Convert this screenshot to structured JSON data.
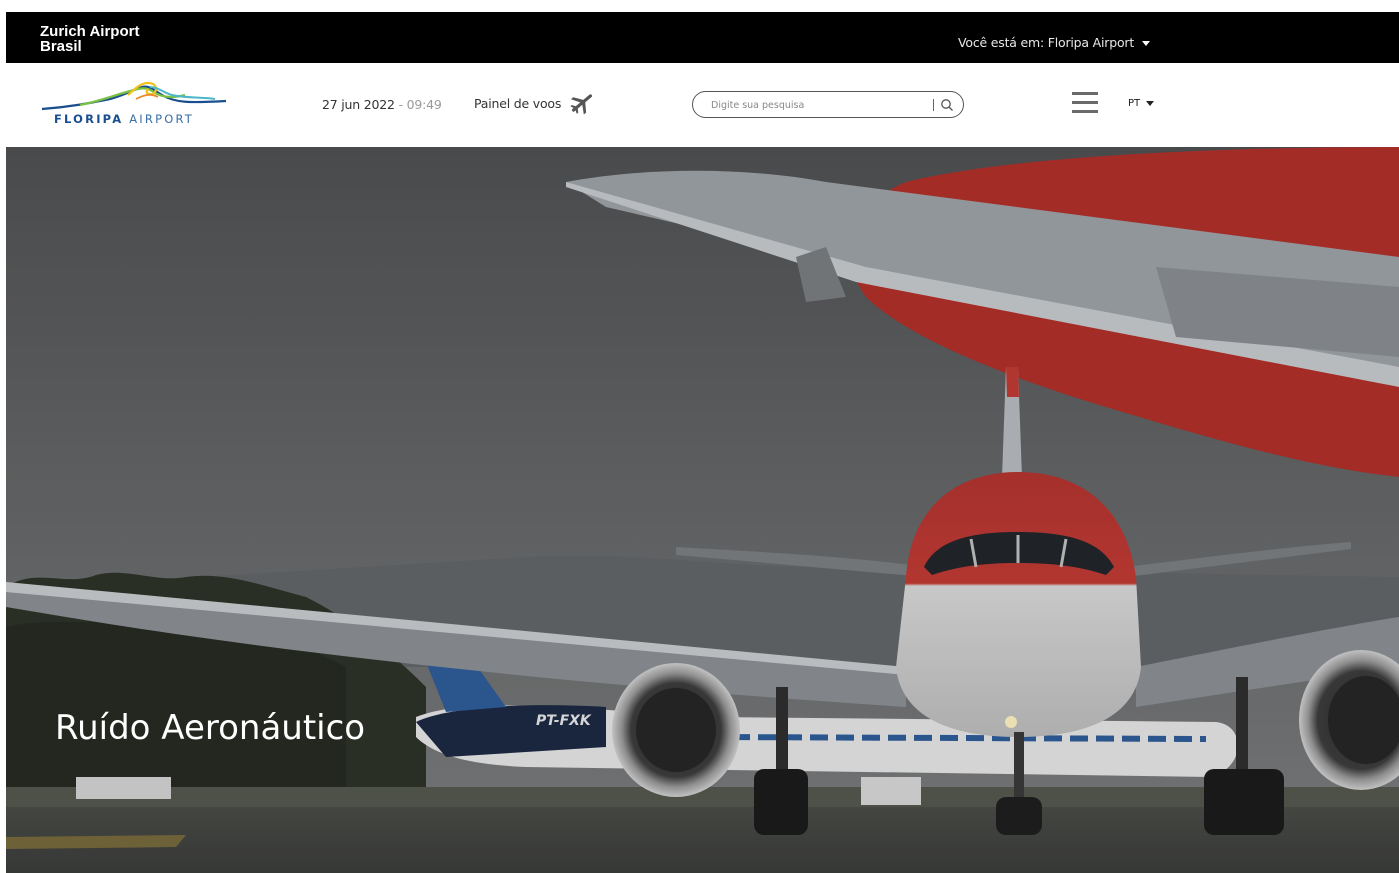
{
  "topbar": {
    "brand_line1": "Zurich Airport",
    "brand_line2": "Brasil",
    "location_text": "Você está em: Floripa Airport"
  },
  "header": {
    "logo_text_bold": "FLORIPA",
    "logo_text_light": "AIRPORT",
    "date": "27 jun 2022",
    "separator": " - ",
    "time": "09:49",
    "flights_label": "Painel de voos",
    "search_placeholder": "Digite sua pesquisa",
    "language": "PT"
  },
  "hero": {
    "title": "Ruído Aeronáutico",
    "aircraft_registration": "PT-FXK"
  },
  "colors": {
    "topbar_bg": "#000000",
    "logo_blue": "#1a4f8f",
    "logo_green": "#7cc242",
    "logo_yellow": "#f2c318",
    "aircraft_red": "#c0312b"
  },
  "icons": {
    "flights": "airplane-icon",
    "search": "search-icon",
    "menu": "hamburger-menu-icon",
    "dropdown": "caret-down-icon"
  }
}
